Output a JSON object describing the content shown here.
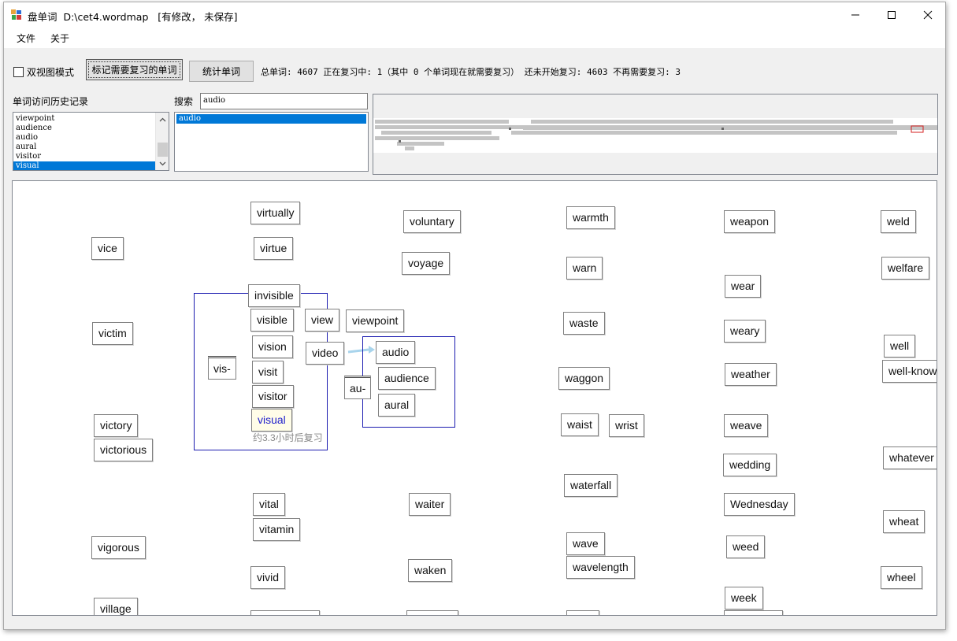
{
  "window": {
    "title": "盘单词  D:\\cet4.wordmap   [有修改， 未保存]",
    "minimize_label": "minimize",
    "maximize_label": "maximize",
    "close_label": "close"
  },
  "menu": {
    "file": "文件",
    "about": "关于"
  },
  "toolbar": {
    "dual_view_label": "双视图模式",
    "dual_view_checked": false,
    "mark_review_button": "标记需要复习的单词",
    "stats_button": "统计单词",
    "stats_text": "总单词: 4607 正在复习中: 1（其中 0 个单词现在就需要复习） 还未开始复习: 4603 不再需要复习: 3"
  },
  "history": {
    "label": "单词访问历史记录",
    "items": [
      "viewpoint",
      "audience",
      "audio",
      "aural",
      "visitor",
      "visual"
    ],
    "selected_index": 5
  },
  "search": {
    "label": "搜索",
    "value": "audio",
    "results": [
      "audio"
    ],
    "selected_index": 0
  },
  "map": {
    "colors": {
      "group_border": "#1c1cb0",
      "selected_word_text": "#2222cc",
      "arrow": "#a8d4ec"
    },
    "words": [
      "virtually",
      "voluntary",
      "warmth",
      "weapon",
      "weld",
      "vice",
      "virtue",
      "voyage",
      "warn",
      "welfare",
      "wear",
      "invisible",
      "visible",
      "view",
      "viewpoint",
      "waste",
      "weary",
      "victim",
      "vision",
      "video",
      "audio",
      "well",
      "vis-",
      "visit",
      "au-",
      "audience",
      "waggon",
      "weather",
      "well-know",
      "visitor",
      "aural",
      "victory",
      "visual",
      "waist",
      "wrist",
      "weave",
      "victorious",
      "whatever",
      "wedding",
      "waterfall",
      "vital",
      "waiter",
      "Wednesday",
      "wheat",
      "vitamin",
      "wave",
      "weed",
      "vigorous",
      "wavelength",
      "vivid",
      "waken",
      "wheel",
      "week",
      "village"
    ],
    "selected_word": "visual",
    "review_note": "约3.3小时后复习"
  }
}
